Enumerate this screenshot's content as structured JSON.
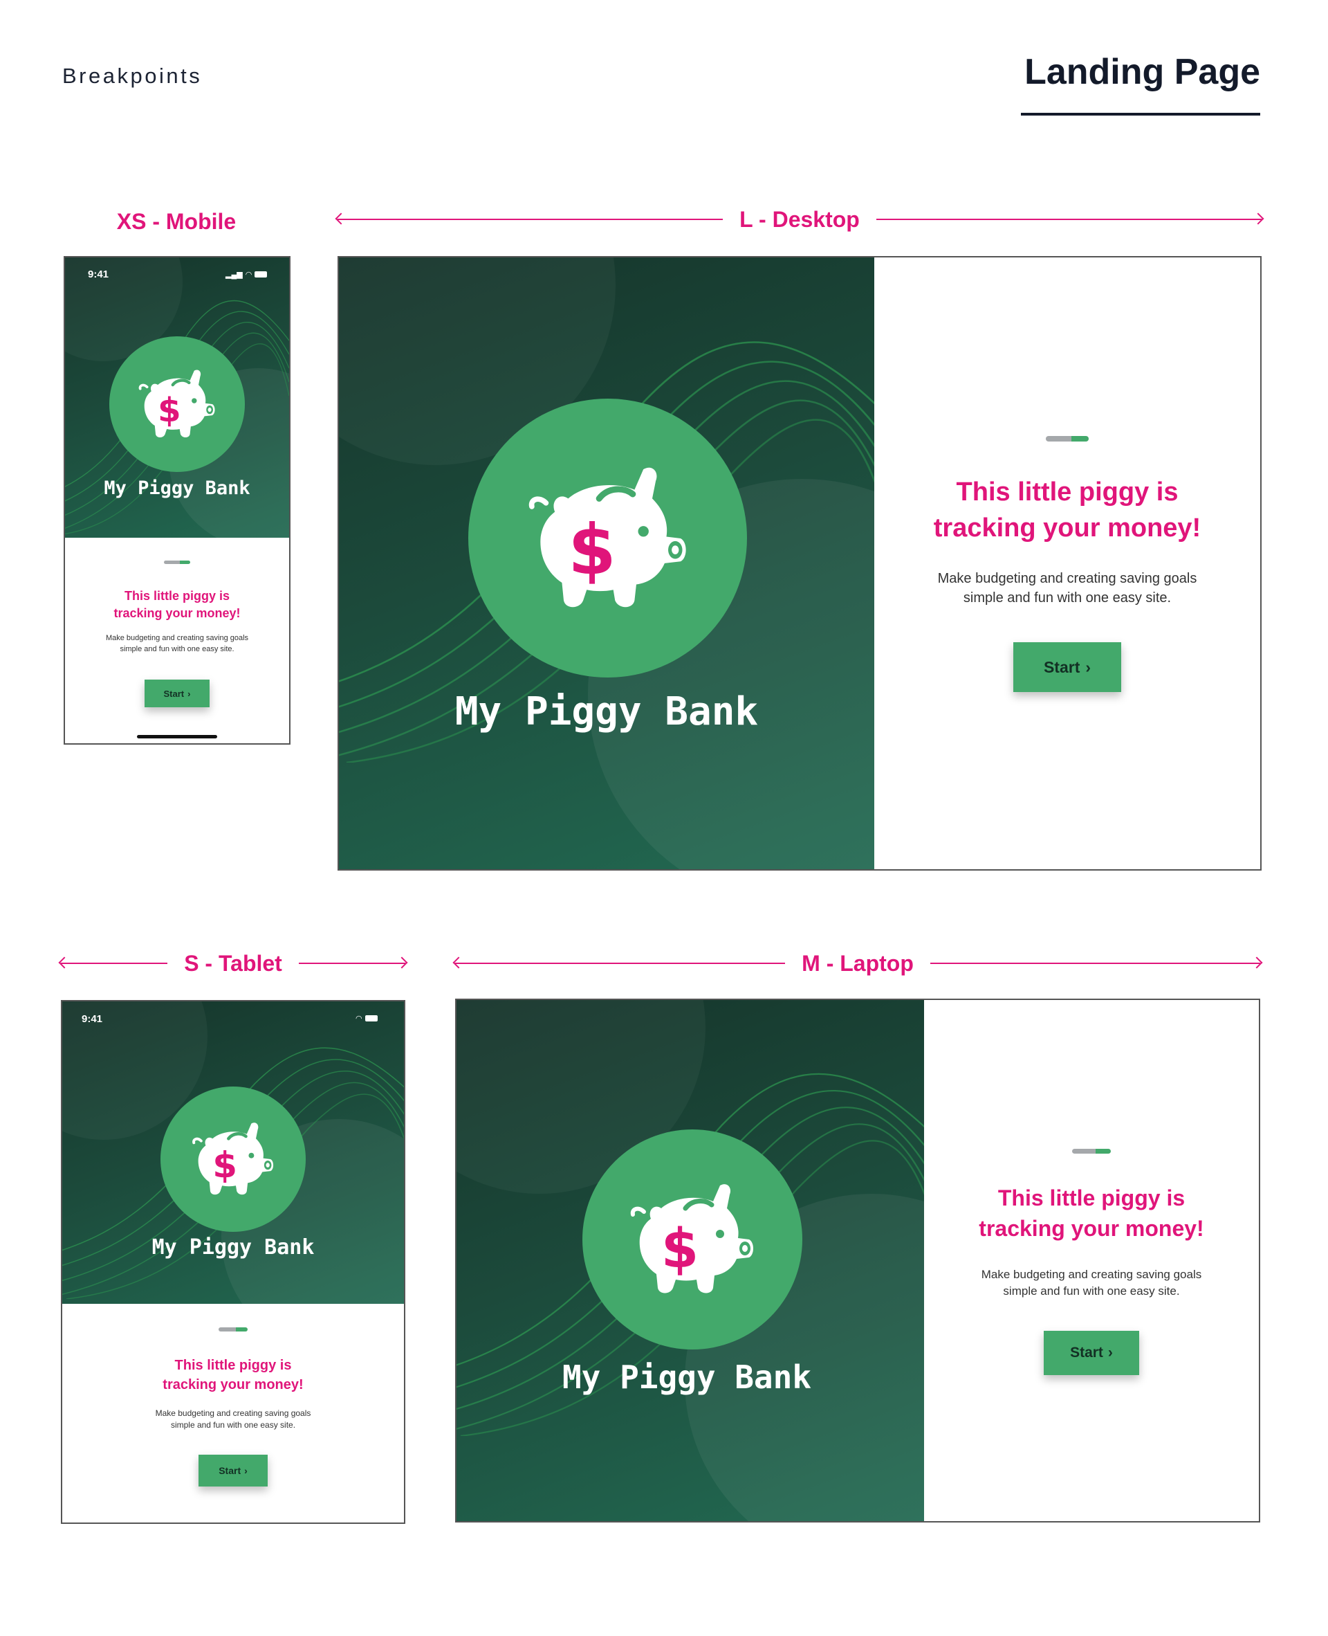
{
  "header": {
    "kicker": "Breakpoints",
    "title": "Landing Page"
  },
  "colors": {
    "accent": "#e0157a",
    "brand_green": "#43a96b",
    "dark_green": "#1c4a3b"
  },
  "icons": {
    "logo": "piggy-bank-icon",
    "button_chevron": "chevron-right-icon",
    "status": [
      "signal-icon",
      "wifi-icon",
      "battery-icon"
    ]
  },
  "breakpoints": {
    "xs": {
      "label": "XS - Mobile",
      "status_time": "9:41",
      "brand": "My Piggy Bank",
      "progress_percent": 60,
      "headline_line1": "This little piggy is",
      "headline_line2": "tracking your money!",
      "body_line1": "Make budgeting and creating saving goals",
      "body_line2": "simple and fun with one easy site.",
      "button": "Start"
    },
    "l": {
      "label": "L - Desktop",
      "brand": "My Piggy Bank",
      "progress_percent": 60,
      "headline_line1": "This little piggy is",
      "headline_line2": "tracking your money!",
      "body_line1": "Make budgeting and creating saving goals",
      "body_line2": "simple and fun with one easy site.",
      "button": "Start"
    },
    "s": {
      "label": "S - Tablet",
      "status_time": "9:41",
      "brand": "My Piggy Bank",
      "progress_percent": 60,
      "headline_line1": "This little piggy is",
      "headline_line2": "tracking your money!",
      "body_line1": "Make budgeting and creating saving goals",
      "body_line2": "simple and fun with one easy site.",
      "button": "Start"
    },
    "m": {
      "label": "M - Laptop",
      "brand": "My Piggy Bank",
      "progress_percent": 60,
      "headline_line1": "This little piggy is",
      "headline_line2": "tracking your money!",
      "body_line1": "Make budgeting and creating saving goals",
      "body_line2": "simple and fun with one easy site.",
      "button": "Start"
    }
  }
}
